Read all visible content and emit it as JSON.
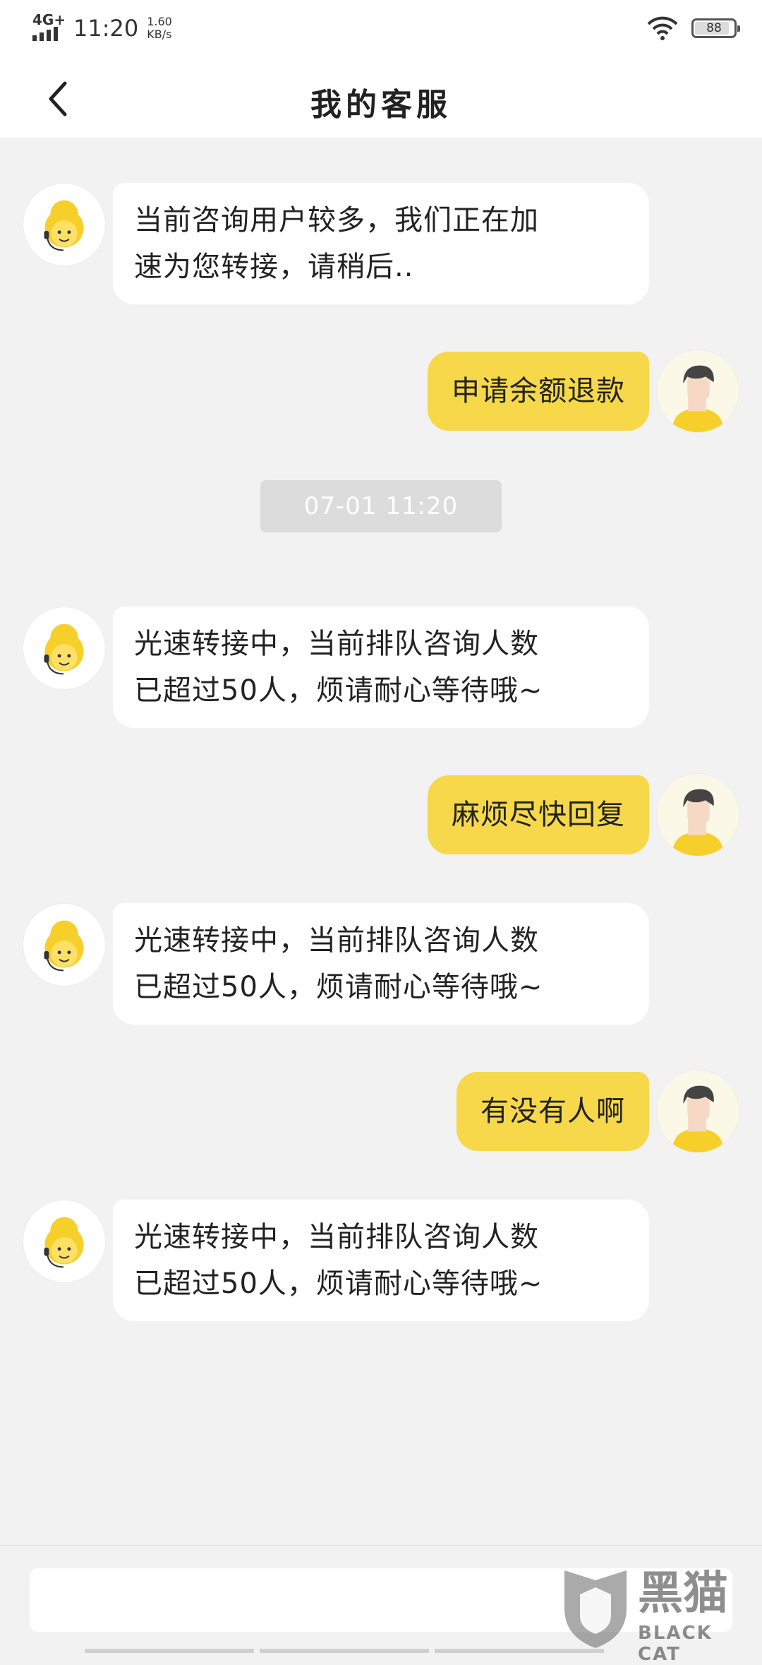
{
  "status_bar": {
    "network": "4G+",
    "time": "11:20",
    "speed_value": "1.60",
    "speed_unit": "KB/s",
    "battery": "88",
    "battery_level": 0.88
  },
  "header": {
    "back_icon": "chevron-left-icon",
    "title": "我的客服"
  },
  "messages": [
    {
      "sender": "agent",
      "avatar_icon": "customer-service-agent-icon",
      "lines": [
        "当前咨询用户较多，我们正在加",
        "速为您转接，请稍后.."
      ]
    },
    {
      "sender": "user",
      "avatar_icon": "user-avatar-icon",
      "text": "申请余额退款"
    },
    {
      "type": "timestamp",
      "text": "07-01 11:20"
    },
    {
      "sender": "agent",
      "avatar_icon": "customer-service-agent-icon",
      "lines": [
        "光速转接中，当前排队咨询人数",
        "已超过50人，烦请耐心等待哦~"
      ]
    },
    {
      "sender": "user",
      "avatar_icon": "user-avatar-icon",
      "text": "麻烦尽快回复"
    },
    {
      "sender": "agent",
      "avatar_icon": "customer-service-agent-icon",
      "lines": [
        "光速转接中，当前排队咨询人数",
        "已超过50人，烦请耐心等待哦~"
      ]
    },
    {
      "sender": "user",
      "avatar_icon": "user-avatar-icon",
      "text": "有没有人啊"
    },
    {
      "sender": "agent",
      "avatar_icon": "customer-service-agent-icon",
      "lines": [
        "光速转接中，当前排队咨询人数",
        "已超过50人，烦请耐心等待哦~"
      ]
    }
  ],
  "input": {
    "value": "",
    "placeholder": ""
  },
  "watermark": {
    "text": "黑猫",
    "sub": "BLACK CAT",
    "icon": "black-cat-logo-icon"
  },
  "colors": {
    "user_bubble": "#f6d84a",
    "agent_bubble": "#ffffff",
    "background": "#f2f2f2"
  }
}
